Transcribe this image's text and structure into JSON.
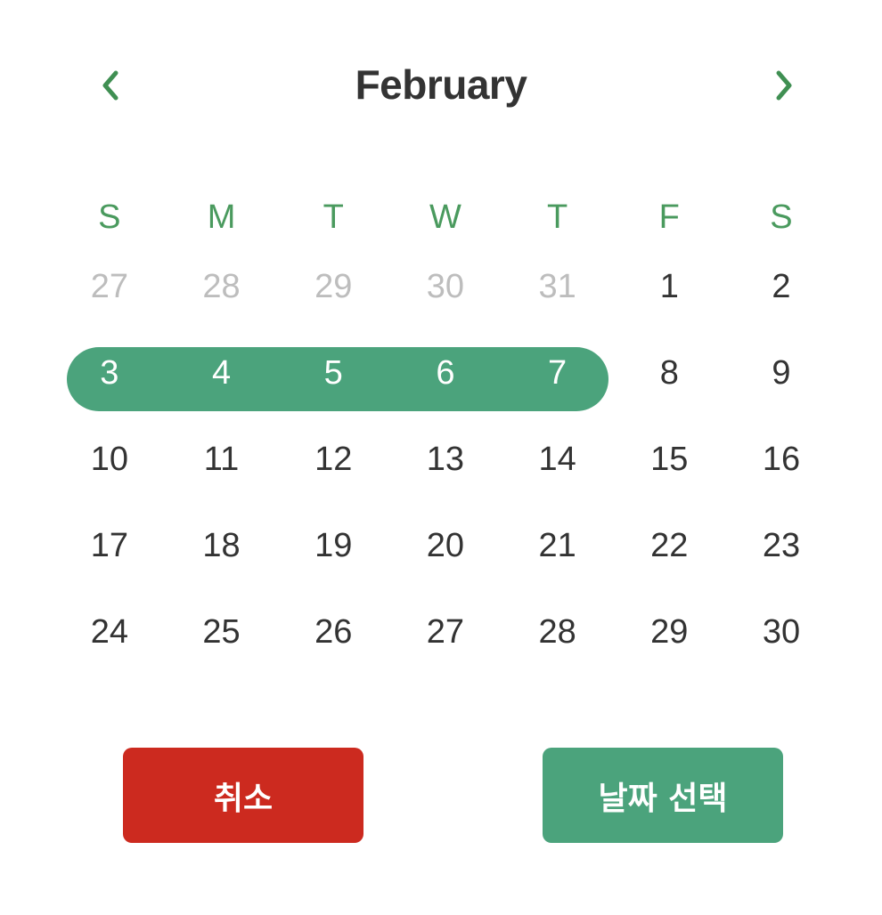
{
  "header": {
    "month": "February",
    "prev_icon": "chevron-left-icon",
    "next_icon": "chevron-right-icon"
  },
  "weekdays": [
    "S",
    "M",
    "T",
    "W",
    "T",
    "F",
    "S"
  ],
  "weeks": [
    [
      {
        "label": "27",
        "muted": true
      },
      {
        "label": "28",
        "muted": true
      },
      {
        "label": "29",
        "muted": true
      },
      {
        "label": "30",
        "muted": true
      },
      {
        "label": "31",
        "muted": true
      },
      {
        "label": "1"
      },
      {
        "label": "2"
      }
    ],
    [
      {
        "label": "3",
        "in_range": true
      },
      {
        "label": "4",
        "in_range": true
      },
      {
        "label": "5",
        "in_range": true
      },
      {
        "label": "6",
        "in_range": true
      },
      {
        "label": "7",
        "in_range": true
      },
      {
        "label": "8"
      },
      {
        "label": "9"
      }
    ],
    [
      {
        "label": "10"
      },
      {
        "label": "11"
      },
      {
        "label": "12"
      },
      {
        "label": "13"
      },
      {
        "label": "14"
      },
      {
        "label": "15"
      },
      {
        "label": "16"
      }
    ],
    [
      {
        "label": "17"
      },
      {
        "label": "18"
      },
      {
        "label": "19"
      },
      {
        "label": "20"
      },
      {
        "label": "21"
      },
      {
        "label": "22"
      },
      {
        "label": "23"
      }
    ],
    [
      {
        "label": "24"
      },
      {
        "label": "25"
      },
      {
        "label": "26"
      },
      {
        "label": "27"
      },
      {
        "label": "28"
      },
      {
        "label": "29"
      },
      {
        "label": "30"
      }
    ]
  ],
  "actions": {
    "cancel_label": "취소",
    "confirm_label": "날짜 선택"
  },
  "colors": {
    "accent": "#4ba37c",
    "weekday": "#4a9a5e",
    "chevron": "#3f8f52",
    "cancel": "#cc2a1f",
    "confirm": "#4ba37c",
    "muted_text": "#bdbdbd",
    "text": "#333333"
  }
}
